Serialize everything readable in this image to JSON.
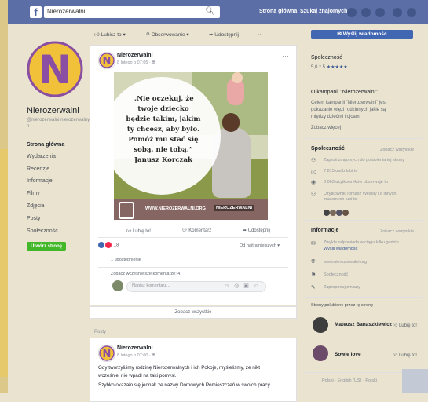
{
  "topbar": {
    "logo": "f",
    "search_value": "Nierozerwalni",
    "search_icon": "search-icon",
    "links": [
      "Strona główna",
      "Szukaj znajomych"
    ]
  },
  "left": {
    "page_name": "Nierozerwalni",
    "handle": "@nierozerwalni.nierozerwalnyc h",
    "nav": [
      "Strona główna",
      "Wydarzenia",
      "Recenzje",
      "Informacje",
      "Filmy",
      "Zdjęcia",
      "Posty",
      "Społeczność"
    ],
    "create_btn": "Utwórz stronę"
  },
  "actions": [
    "Lubisz to",
    "Obserwowanie",
    "Udostępnij"
  ],
  "post": {
    "author": "Nierozerwalni",
    "meta": "8 lutego o 07:05 · ",
    "quote_lines": [
      "„Nie oczekuj, że",
      "twoje dziecko",
      "będzie takim, jakim",
      "ty chcesz, aby było.",
      "Pomóż mu stać się",
      "sobą, nie tobą.”",
      "Janusz Korczak"
    ],
    "image_url": "WWW.NIEROZERWALNI.ORG",
    "image_tag": "NIEROZERWALNI",
    "buttons": [
      "Lubię to!",
      "Komentarz",
      "Udostępnij"
    ],
    "reactions_count": "18",
    "comment_order": "Od najtrafniejszych",
    "shares": "1 udostępnienie",
    "view_comments": "Zobacz wcześniejsze komentarze: 4",
    "comment_placeholder": "Napisz komentarz...",
    "comment_icons": "☺ ◎ ▣ ☺"
  },
  "see_all": "Zobacz wszystkie",
  "posts_header": "Posty",
  "post2": {
    "author": "Nierozerwalni",
    "meta": "8 lutego o 07:00 · ",
    "line1": "Gdy tworzyliśmy rodzinę Nierozerwalnych i ich Pokoje, myśleliśmy, że nikt",
    "line2": "wcześniej nie wpadł na taki pomysł.",
    "line3": "Szybko okazało się jednak że nazwy Domowych Pomieszczeń w swoich pracy"
  },
  "right": {
    "send_btn": "Wyślij wiadomość",
    "community_h": "Społeczność",
    "rating_prefix": "5,0 z 5 ",
    "stars": "★★★★★",
    "about_h": "O kampanii \"Nierozerwalni\"",
    "about_text": [
      "Celem kampanii \"Nierozerwalni\" jest",
      "pokazanie więzi rodzinnych jakie są",
      "między dziećmi i ojcami"
    ],
    "see_more": "Zobacz więcej",
    "spol_h": "Społeczność",
    "spol_link": "Zobacz wszystkie",
    "spol_items": [
      "Zaproś znajomych do polubienia tej strony",
      "7 815 osób lubi to",
      "8 063 użytkowników obserwuje to",
      "Użytkownik Tomasz Wesoły i 8 innych znajomych lubi to"
    ],
    "info_h": "Informacje",
    "info_link": "Zobacz wszystkie",
    "info_items": [
      "Zwykle odpowiada w ciągu kilku godzin",
      "Wyślij wiadomość",
      "www.nierozerwalni.org",
      "Społeczność",
      "Zaproponuj zmiany"
    ],
    "liked_h": "Strony polubione przez tę stronę",
    "liked": [
      {
        "name": "Mateusz Banaszkiewicz",
        "btn": "Lubię to!"
      },
      {
        "name": "Sowie love",
        "btn": "Lubię to!"
      }
    ],
    "footer": "Polski · English (US) · Polski"
  },
  "colors": {
    "fb_blue": "#4267b2",
    "topbar": "#5b6fa6",
    "green": "#42b72a",
    "logo_purple": "#8a4fa3",
    "logo_yellow": "#f2c13a"
  }
}
